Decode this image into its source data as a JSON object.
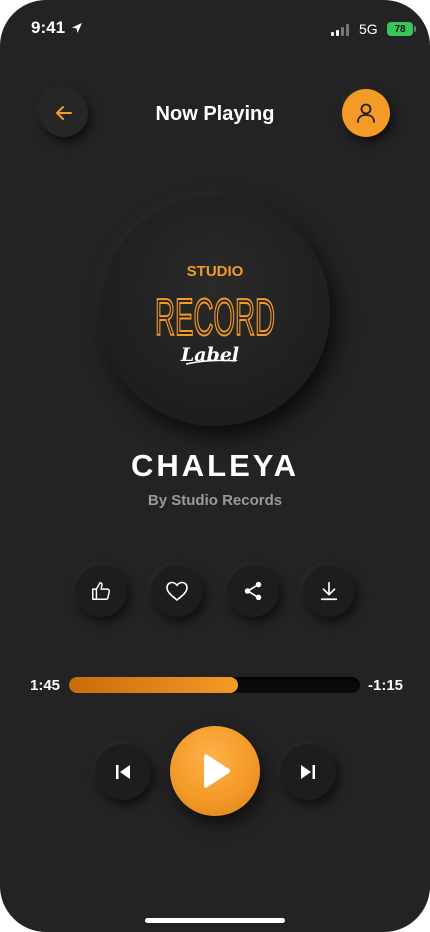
{
  "status_bar": {
    "time": "9:41",
    "network": "5G",
    "battery": "78"
  },
  "header": {
    "title": "Now Playing"
  },
  "album_art": {
    "logo_top": "STUDIO",
    "logo_main": "RECORD",
    "logo_script": "Label"
  },
  "track": {
    "title": "CHALEYA",
    "artist": "By Studio Records"
  },
  "player": {
    "elapsed": "1:45",
    "remaining": "-1:15",
    "progress": 0.58
  },
  "colors": {
    "accent": "#f39a27",
    "background": "#232323"
  },
  "icons": {
    "back": "arrow-left-icon",
    "profile": "user-icon",
    "like": "thumbs-up-icon",
    "favorite": "heart-icon",
    "share": "share-icon",
    "download": "download-icon",
    "prev": "skip-previous-icon",
    "play": "play-icon",
    "next": "skip-next-icon"
  }
}
